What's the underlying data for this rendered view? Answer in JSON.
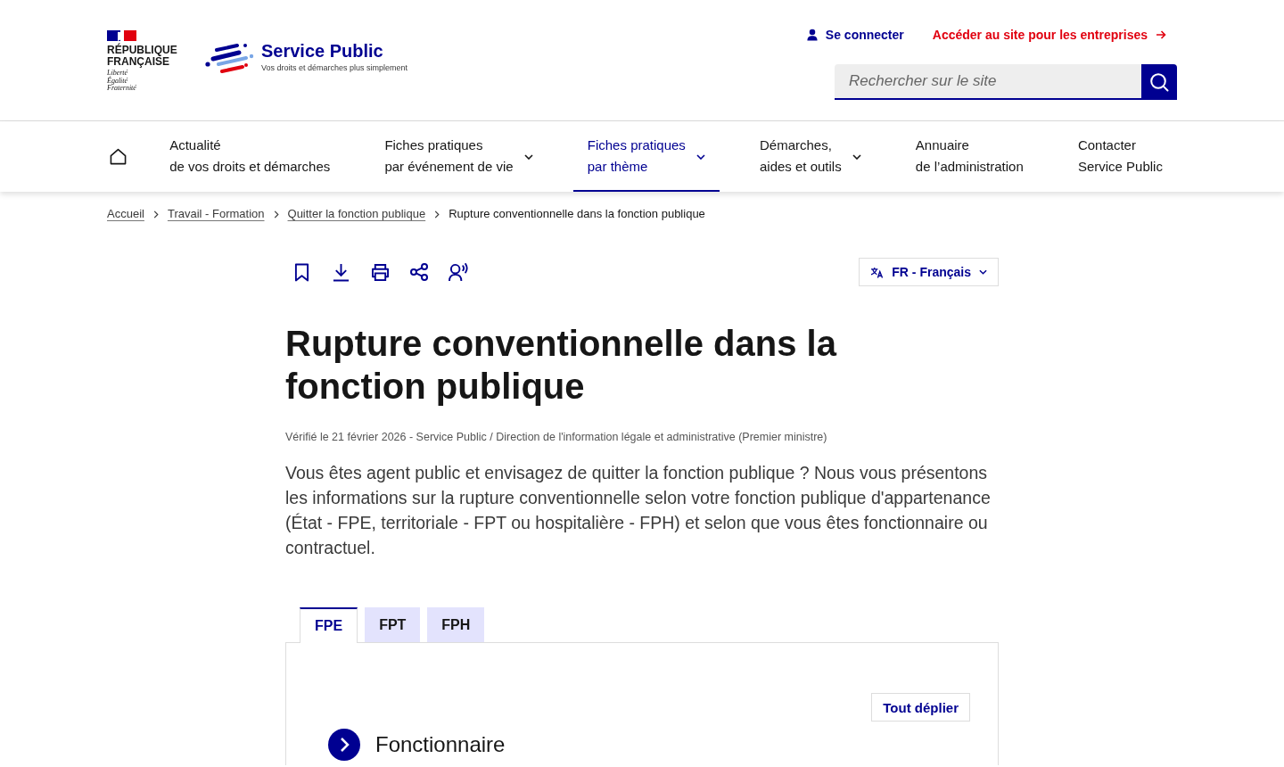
{
  "header": {
    "brand": {
      "lines": [
        "RÉPUBLIQUE",
        "FRANÇAISE"
      ],
      "motto": [
        "Liberté",
        "Égalité",
        "Fraternité"
      ]
    },
    "service": {
      "name": "Service Public",
      "tagline": "Vos droits et démarches plus simplement"
    },
    "links": [
      {
        "label": "Se connecter",
        "kind": "account"
      },
      {
        "label": "Accéder au site pour les entreprises",
        "kind": "external"
      }
    ],
    "search": {
      "placeholder": "Rechercher sur le site"
    }
  },
  "nav": {
    "items": [
      {
        "lines": [
          "Actualité",
          "de vos droits et démarches"
        ],
        "dropdown": false,
        "selected": false
      },
      {
        "lines": [
          "Fiches pratiques",
          "par événement de vie"
        ],
        "dropdown": true,
        "selected": false
      },
      {
        "lines": [
          "Fiches pratiques",
          "par thème"
        ],
        "dropdown": true,
        "selected": true
      },
      {
        "lines": [
          "Démarches,",
          "aides et outils"
        ],
        "dropdown": true,
        "selected": false
      },
      {
        "lines": [
          "Annuaire",
          "de l’administration"
        ],
        "dropdown": false,
        "selected": false
      },
      {
        "lines": [
          "Contacter",
          "Service Public"
        ],
        "dropdown": false,
        "selected": false
      }
    ]
  },
  "breadcrumb": [
    {
      "label": "Accueil",
      "current": false
    },
    {
      "label": "Travail - Formation",
      "current": false
    },
    {
      "label": "Quitter la fonction publique",
      "current": false
    },
    {
      "label": "Rupture conventionnelle dans la fonction publique",
      "current": true
    }
  ],
  "language": {
    "label": "FR - Français"
  },
  "article": {
    "title": "Rupture conventionnelle dans la fonction publique",
    "meta": "Vérifié le 21 février 2026 - Service Public / Direction de l'information légale et administrative (Premier ministre)",
    "intro": "Vous êtes agent public et envisagez de quitter la fonction publique ? Nous vous présentons les informations sur la rupture conventionnelle selon votre fonction publique d'appartenance (État - FPE, territoriale - FPT ou hospitalière - FPH) et selon que vous êtes fonctionnaire ou contractuel."
  },
  "tabs": [
    {
      "label": "FPE",
      "selected": true
    },
    {
      "label": "FPT",
      "selected": false
    },
    {
      "label": "FPH",
      "selected": false
    }
  ],
  "panel": {
    "expand_all": "Tout déplier",
    "sections": [
      {
        "title": "Fonctionnaire",
        "expanded": false
      }
    ]
  }
}
